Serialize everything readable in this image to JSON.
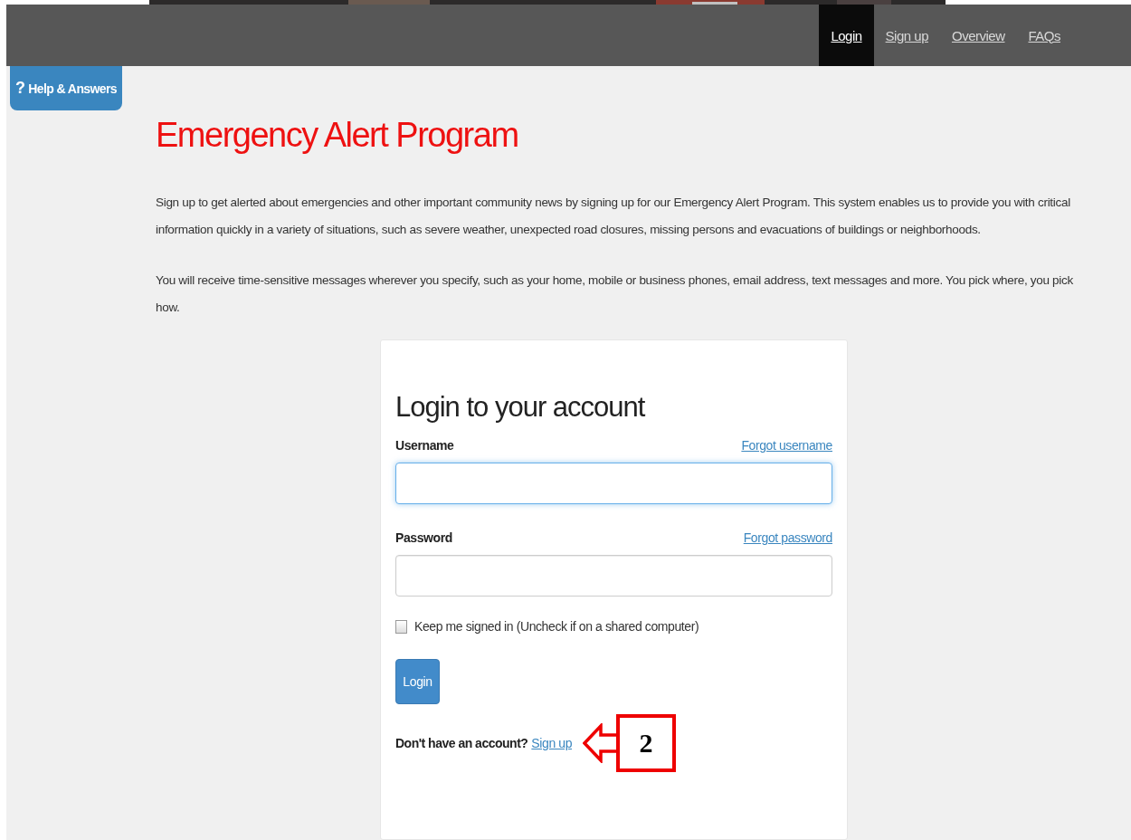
{
  "header": {
    "nav": [
      {
        "label": "Login",
        "selected": true
      },
      {
        "label": "Sign up",
        "selected": false
      },
      {
        "label": "Overview",
        "selected": false
      },
      {
        "label": "FAQs",
        "selected": false
      }
    ]
  },
  "help_tab": {
    "icon": "?",
    "label": "Help & Answers"
  },
  "title": "Emergency Alert Program",
  "paragraphs": [
    "Sign up to get alerted about emergencies and other important community news by signing up for our Emergency Alert Program. This system enables us to provide you with critical information quickly in a variety of situations, such as severe weather, unexpected road closures, missing persons and evacuations of buildings or neighborhoods.",
    "You will receive time-sensitive messages wherever you specify, such as your home, mobile or business phones, email address, text messages and more. You pick where, you pick how."
  ],
  "login": {
    "title": "Login to your account",
    "fields": [
      {
        "label": "Username",
        "link": "Forgot username",
        "focused": true
      },
      {
        "label": "Password",
        "link": "Forgot password",
        "focused": false
      }
    ],
    "remember": {
      "label": "Keep me signed in (Uncheck if on a shared computer)",
      "checked": false
    },
    "button": "Login",
    "signup_prompt": "Don't have an account?",
    "signup_link": "Sign up"
  },
  "callout": {
    "number": "2"
  }
}
